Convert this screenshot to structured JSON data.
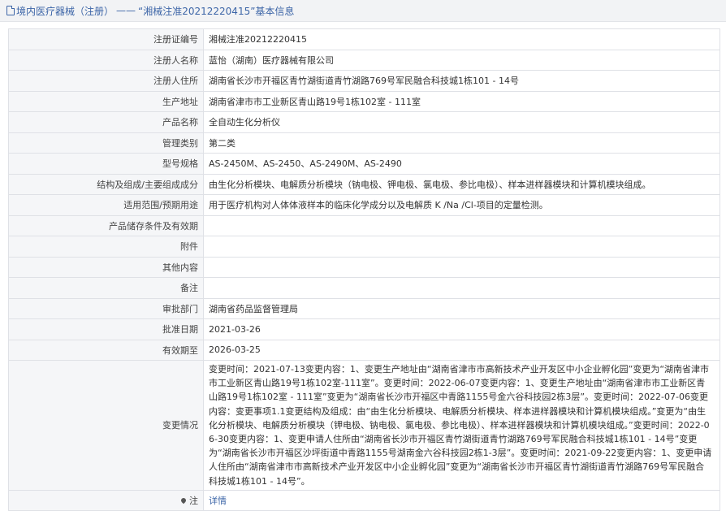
{
  "header": {
    "category": "境内医疗器械（注册）",
    "separator": "——",
    "title": "“湘械注准20212220415”基本信息"
  },
  "rows": [
    {
      "label": "注册证编号",
      "value": "湘械注准20212220415"
    },
    {
      "label": "注册人名称",
      "value": "蓝怡（湖南）医疗器械有限公司"
    },
    {
      "label": "注册人住所",
      "value": "湖南省长沙市开福区青竹湖街道青竹湖路769号军民融合科技城1栋101 - 14号"
    },
    {
      "label": "生产地址",
      "value": "湖南省津市市工业新区青山路19号1栋102室 - 111室"
    },
    {
      "label": "产品名称",
      "value": "全自动生化分析仪"
    },
    {
      "label": "管理类别",
      "value": "第二类"
    },
    {
      "label": "型号规格",
      "value": "AS-2450M、AS-2450、AS-2490M、AS-2490"
    },
    {
      "label": "结构及组成/主要组成成分",
      "value": "由生化分析模块、电解质分析模块（钠电极、钾电极、氯电极、参比电极）、样本进样器模块和计算机模块组成。"
    },
    {
      "label": "适用范围/预期用途",
      "value": "用于医疗机构对人体体液样本的临床化学成分以及电解质 K /Na /Cl-项目的定量检测。"
    },
    {
      "label": "产品储存条件及有效期",
      "value": ""
    },
    {
      "label": "附件",
      "value": ""
    },
    {
      "label": "其他内容",
      "value": ""
    },
    {
      "label": "备注",
      "value": ""
    },
    {
      "label": "审批部门",
      "value": "湖南省药品监督管理局"
    },
    {
      "label": "批准日期",
      "value": "2021-03-26"
    },
    {
      "label": "有效期至",
      "value": "2026-03-25"
    },
    {
      "label": "变更情况",
      "value": "变更时间：2021-07-13变更内容：1、变更生产地址由“湖南省津市市高新技术产业开发区中小企业孵化园”变更为“湖南省津市市工业新区青山路19号1栋102室-111室”。变更时间：2022-06-07变更内容：1、变更生产地址由“湖南省津市市工业新区青山路19号1栋102室 - 111室”变更为“湖南省长沙市开福区中青路1155号金六谷科技园2栋3层”。变更时间：2022-07-06变更内容：变更事项1.1变更结构及组成：由“由生化分析模块、电解质分析模块、样本进样器模块和计算机模块组成。”变更为“由生化分析模块、电解质分析模块（钾电极、钠电极、氯电极、参比电极）、样本进样器模块和计算机模块组成。”变更时间：2022-06-30变更内容：1、变更申请人住所由“湖南省长沙市开福区青竹湖街道青竹湖路769号军民融合科技城1栋101 - 14号”变更为“湖南省长沙市开福区沙坪街道中青路1155号湖南金六谷科技园2栋1-3层”。变更时间：2021-09-22变更内容：1、变更申请人住所由“湖南省津市市高新技术产业开发区中小企业孵化园”变更为“湖南省长沙市开福区青竹湖街道青竹湖路769号军民融合科技城1栋101 - 14号”。"
    },
    {
      "label": "注",
      "value": "详情"
    }
  ],
  "icons": {
    "header_icon": "document-icon",
    "note_icon": "location-pin-icon"
  },
  "colors": {
    "link": "#3c65a7",
    "label_bg": "#f5f6f8",
    "border": "#dfe1e6",
    "header_bg": "#f2f3f5"
  }
}
